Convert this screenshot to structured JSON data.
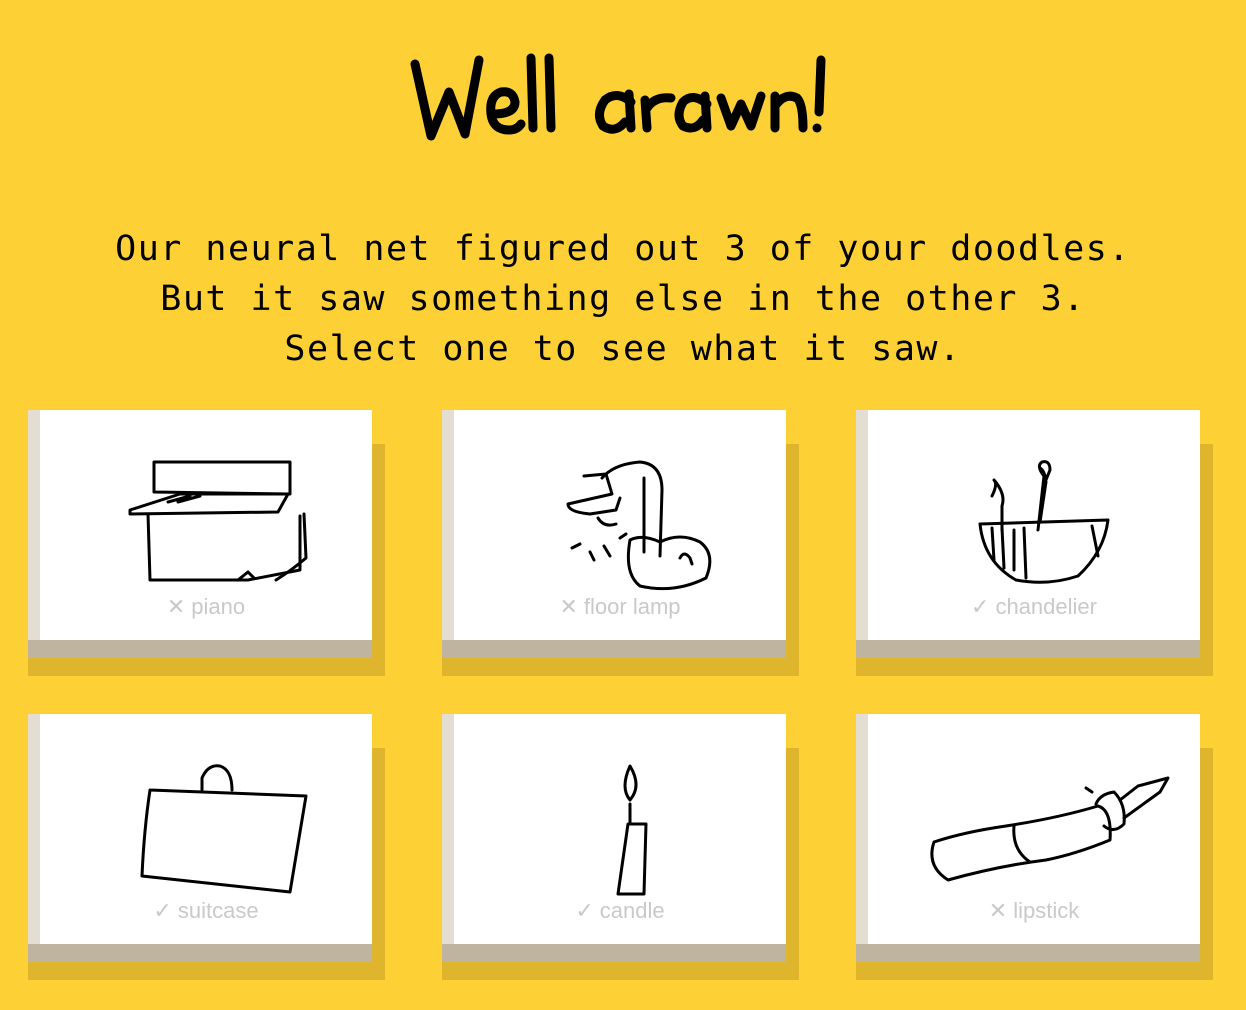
{
  "title": "Well drawn!",
  "message": {
    "line1": "Our neural net figured out 3 of your doodles.",
    "line2": "But it saw something else in the other 3.",
    "line3": "Select one to see what it saw."
  },
  "doodles": [
    {
      "label": "piano",
      "recognized": false,
      "mark": "✕",
      "icon": "piano-doodle"
    },
    {
      "label": "floor lamp",
      "recognized": false,
      "mark": "✕",
      "icon": "floor-lamp-doodle"
    },
    {
      "label": "chandelier",
      "recognized": true,
      "mark": "✓",
      "icon": "chandelier-doodle"
    },
    {
      "label": "suitcase",
      "recognized": true,
      "mark": "✓",
      "icon": "suitcase-doodle"
    },
    {
      "label": "candle",
      "recognized": true,
      "mark": "✓",
      "icon": "candle-doodle"
    },
    {
      "label": "lipstick",
      "recognized": false,
      "mark": "✕",
      "icon": "lipstick-doodle"
    }
  ],
  "colors": {
    "background": "#FDD035",
    "card_face": "#FFFFFF",
    "label_text": "#C9C9C9"
  }
}
